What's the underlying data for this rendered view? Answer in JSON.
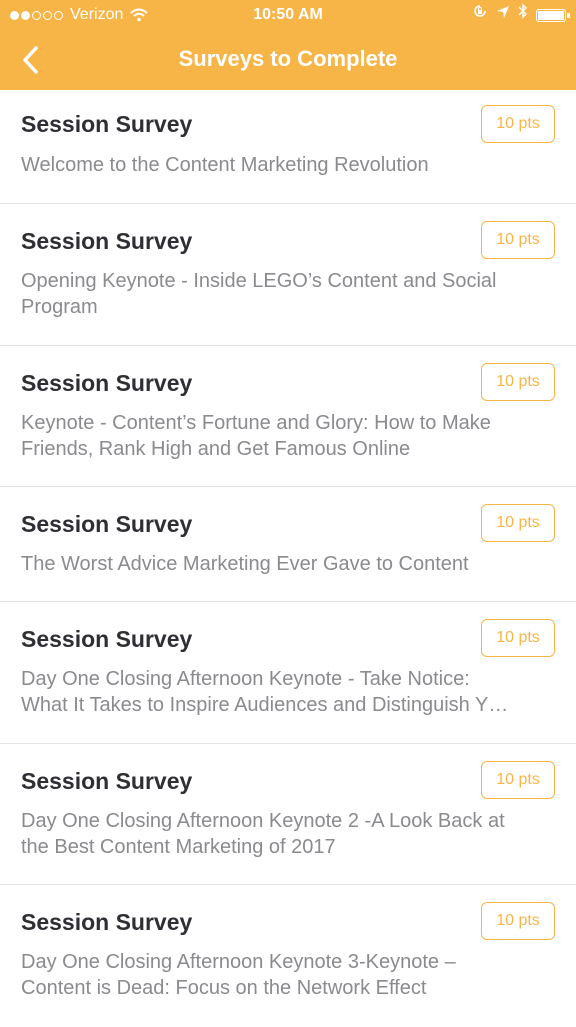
{
  "status_bar": {
    "carrier": "Verizon",
    "time": "10:50 AM",
    "signal_bars": 2,
    "signal_total": 5,
    "icons": [
      "wifi-icon",
      "rotation-lock-icon",
      "location-arrow-icon",
      "bluetooth-icon",
      "battery-icon"
    ]
  },
  "header": {
    "title": "Surveys to Complete",
    "back_icon": "chevron-left-icon",
    "color": "#f8b547"
  },
  "surveys": [
    {
      "title": "Session Survey",
      "subtitle": [
        "Welcome to the Content Marketing Revolution"
      ],
      "points": "10 pts"
    },
    {
      "title": "Session Survey",
      "subtitle": [
        "Opening Keynote - Inside LEGO’s Content and Social",
        "Program"
      ],
      "points": "10 pts"
    },
    {
      "title": "Session Survey",
      "subtitle": [
        "Keynote - Content’s Fortune and Glory: How to Make",
        "Friends, Rank  High and Get Famous Online"
      ],
      "points": "10 pts"
    },
    {
      "title": "Session Survey",
      "subtitle": [
        "The Worst Advice Marketing Ever Gave to Content"
      ],
      "points": "10 pts"
    },
    {
      "title": "Session Survey",
      "subtitle": [
        "Day One Closing Afternoon Keynote - Take Notice:",
        "What It Takes to Inspire Audiences and Distinguish Y…"
      ],
      "points": "10 pts"
    },
    {
      "title": "Session Survey",
      "subtitle": [
        "Day One Closing Afternoon Keynote 2 -A Look Back at",
        "the Best Content Marketing of 2017"
      ],
      "points": "10 pts"
    },
    {
      "title": "Session Survey",
      "subtitle": [
        "Day One Closing Afternoon Keynote 3-Keynote –",
        "Content is Dead: Focus on the Network Effect"
      ],
      "points": "10 pts"
    }
  ]
}
